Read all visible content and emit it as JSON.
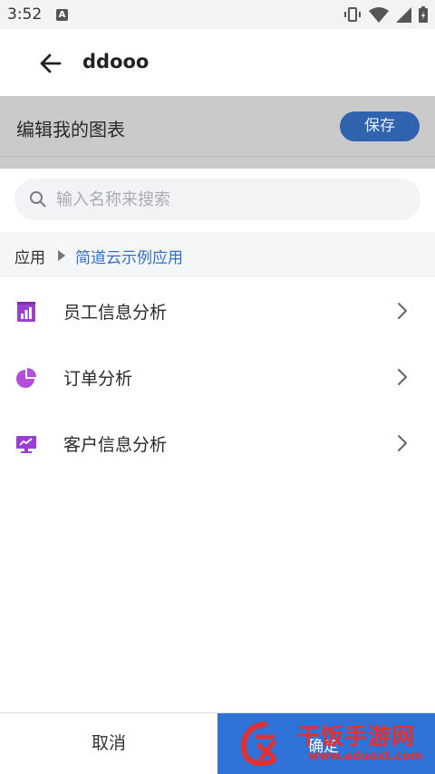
{
  "status_bar": {
    "time": "3:52",
    "a_icon": "A"
  },
  "app_bar": {
    "title": "ddooo",
    "back_icon": "arrow-left-icon"
  },
  "edit_header": {
    "title": "编辑我的图表",
    "save_label": "保存"
  },
  "search": {
    "placeholder": "输入名称来搜索",
    "value": ""
  },
  "breadcrumb": {
    "root": "应用",
    "current": "简道云示例应用"
  },
  "list": {
    "items": [
      {
        "label": "员工信息分析",
        "icon": "bar-chart-icon",
        "icon_color": "#9b3fd3"
      },
      {
        "label": "订单分析",
        "icon": "pie-chart-icon",
        "icon_color": "#b44fd8"
      },
      {
        "label": "客户信息分析",
        "icon": "monitor-chart-icon",
        "icon_color": "#9b3fd3"
      }
    ]
  },
  "bottom_bar": {
    "cancel_label": "取消",
    "confirm_label": "确定"
  },
  "watermark": {
    "title": "干饭手游网",
    "url": "www.eduext.com"
  },
  "colors": {
    "accent": "#2f73d8",
    "save_button": "#2f63ad",
    "breadcrumb_link": "#2f6fcf",
    "icon_purple": "#9b3fd3",
    "watermark_red": "#e03030"
  }
}
